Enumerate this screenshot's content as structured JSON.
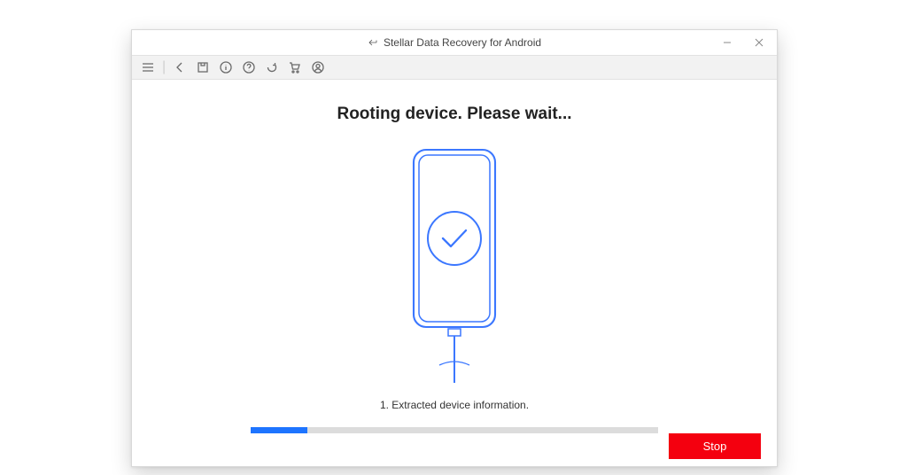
{
  "window": {
    "title": "Stellar Data Recovery for Android"
  },
  "content": {
    "heading": "Rooting device. Please wait...",
    "step": "1. Extracted device information.",
    "progress_percent": 14
  },
  "buttons": {
    "stop": "Stop"
  },
  "toolbar": {
    "menu": "menu",
    "back": "back",
    "save": "save",
    "info": "info",
    "help": "help",
    "refresh": "refresh",
    "cart": "cart",
    "user": "user"
  },
  "win_controls": {
    "minimize": "minimize",
    "close": "close"
  },
  "colors": {
    "accent": "#1e74ff",
    "danger": "#f4000f"
  }
}
